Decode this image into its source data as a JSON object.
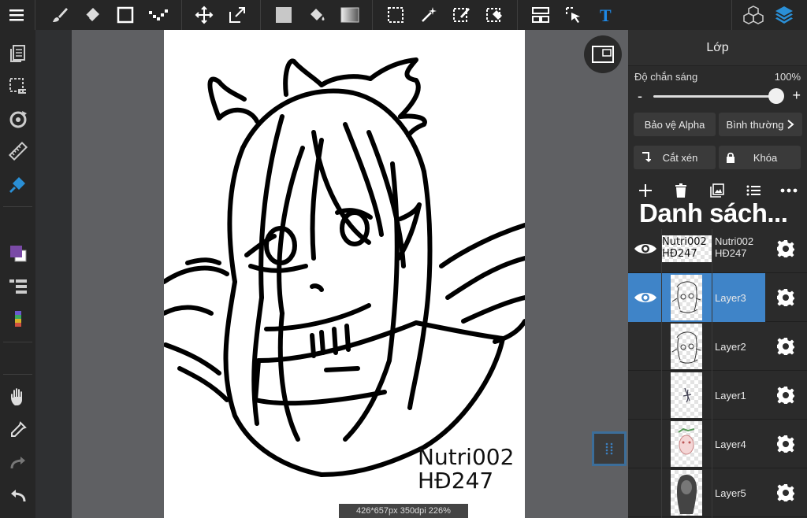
{
  "app": {
    "accent": "#3f84c8",
    "text_color": "#1e88e5"
  },
  "canvas": {
    "watermark_line1": "Nutri002",
    "watermark_line2": "HĐ247",
    "status": "426*657px 350dpi 226%"
  },
  "top_toolbar": {
    "icons": [
      "menu-icon",
      "brush-icon",
      "eraser-icon",
      "rectangle-icon",
      "dotted-line-icon",
      "move-icon",
      "transform-icon",
      "fill-color-icon",
      "bucket-icon",
      "gradient-icon",
      "select-rect-icon",
      "magic-wand-icon",
      "select-pen-icon",
      "select-eraser-icon",
      "layout-icon",
      "select-arrow-icon",
      "text-icon",
      "3d-model-icon",
      "layers-icon"
    ]
  },
  "left_toolbar": {
    "icons": [
      "pages-icon",
      "selection-icon",
      "rotate-icon",
      "ruler-icon",
      "fill-tool-icon",
      "color-swatch-icon",
      "layer-list-icon",
      "color-strip-icon",
      "hand-icon",
      "eyedropper-icon",
      "redo-icon",
      "undo-icon"
    ]
  },
  "panel": {
    "title": "Lớp",
    "opacity_label": "Độ chắn sáng",
    "opacity_value": "100%",
    "opacity_fraction": 1.0,
    "minus": "-",
    "plus": "+",
    "alpha_protect": "Bảo vệ Alpha",
    "blend_mode": "Bình thường",
    "clip": "Cắt xén",
    "lock": "Khóa",
    "list_title": "Danh sách..."
  },
  "layers": [
    {
      "name": "Nutri002\nHĐ247",
      "visible": true,
      "selected": false,
      "thumb": "text"
    },
    {
      "name": "Layer3",
      "visible": true,
      "selected": true,
      "thumb": "sketch"
    },
    {
      "name": "Layer2",
      "visible": false,
      "selected": false,
      "thumb": "sketch"
    },
    {
      "name": "Layer1",
      "visible": false,
      "selected": false,
      "thumb": "small"
    },
    {
      "name": "Layer4",
      "visible": false,
      "selected": false,
      "thumb": "color"
    },
    {
      "name": "Layer5",
      "visible": false,
      "selected": false,
      "thumb": "silhouette"
    }
  ]
}
